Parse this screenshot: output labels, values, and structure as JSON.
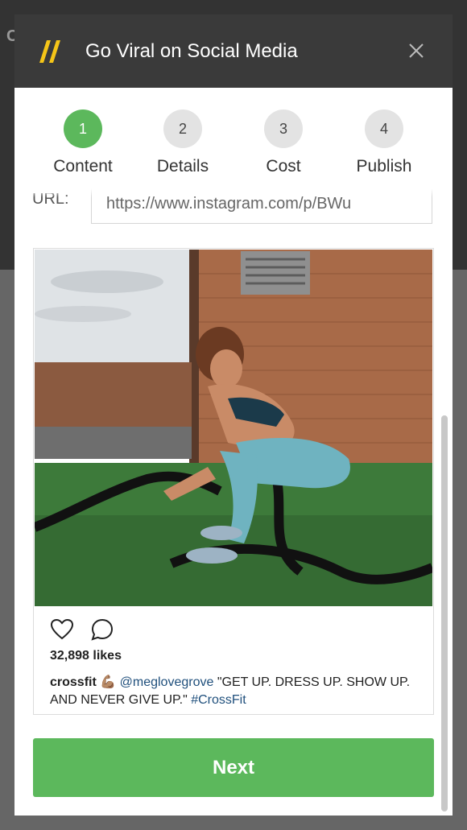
{
  "background": {
    "logo_text": "C"
  },
  "modal": {
    "title": "Go Viral on Social Media",
    "brand_color": "#f5c518",
    "header_color": "#3a3a3a"
  },
  "stepper": {
    "accent": "#5cb85c",
    "steps": [
      {
        "number": "1",
        "label": "Content",
        "active": true
      },
      {
        "number": "2",
        "label": "Details",
        "active": false
      },
      {
        "number": "3",
        "label": "Cost",
        "active": false
      },
      {
        "number": "4",
        "label": "Publish",
        "active": false
      }
    ]
  },
  "url_field": {
    "label": "URL:",
    "value": "https://www.instagram.com/p/BWu"
  },
  "post": {
    "likes": "32,898 likes",
    "username": "crossfit",
    "emoji": "💪🏽",
    "mention": "@meglovegrove",
    "caption_text": " \"GET UP. DRESS UP. SHOW UP. AND NEVER GIVE UP.\" ",
    "hashtag": "#CrossFit"
  },
  "next_button": {
    "label": "Next"
  },
  "icons": [
    "brand-slash-icon",
    "close-icon",
    "heart-icon",
    "comment-icon"
  ]
}
